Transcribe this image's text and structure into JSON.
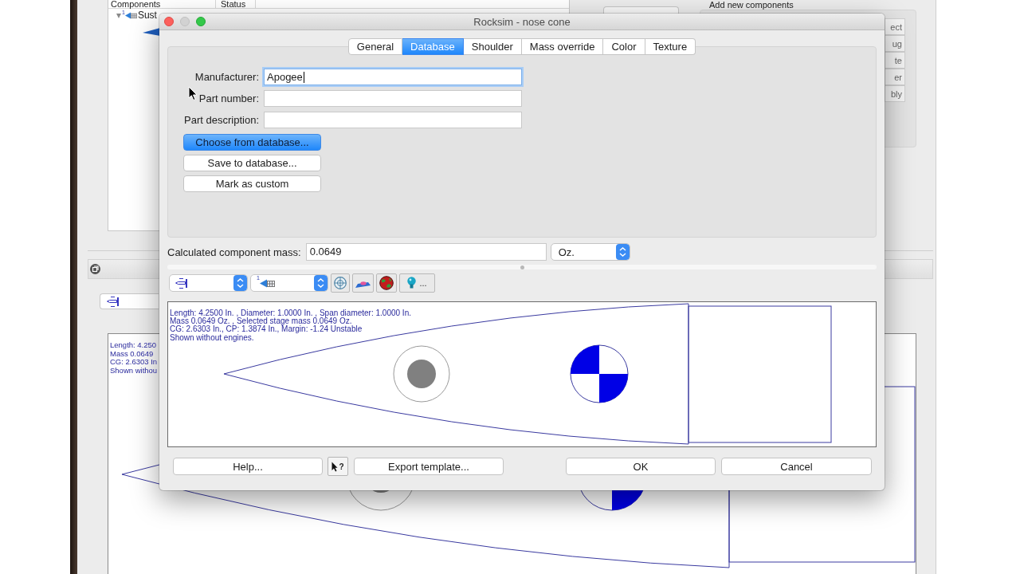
{
  "background_window": {
    "components_list": {
      "columns": [
        "Components",
        "Status"
      ],
      "items": [
        {
          "stage_number": "1",
          "label": "Sust",
          "expanded": true
        }
      ]
    },
    "add_components": {
      "title": "Add new components",
      "buttons": [
        "ect",
        "ug",
        "te",
        "er",
        "bly"
      ]
    },
    "drawing": {
      "info_lines": [
        "Length: 4.250",
        "Mass 0.0649",
        "CG: 2.6303 In",
        "Shown withou"
      ]
    }
  },
  "dialog": {
    "title": "Rocksim - nose cone",
    "tabs": [
      {
        "label": "General",
        "selected": false
      },
      {
        "label": "Database",
        "selected": true
      },
      {
        "label": "Shoulder",
        "selected": false
      },
      {
        "label": "Mass override",
        "selected": false
      },
      {
        "label": "Color",
        "selected": false
      },
      {
        "label": "Texture",
        "selected": false
      }
    ],
    "fields": [
      {
        "label": "Manufacturer:",
        "value": "Apogee",
        "focused": true
      },
      {
        "label": "Part number:",
        "focused": false
      },
      {
        "label": "Part description:",
        "focused": false
      }
    ],
    "database_buttons": [
      {
        "label": "Choose from database...",
        "default": true
      },
      {
        "label": "Save to database...",
        "default": false
      },
      {
        "label": "Mark as custom",
        "default": false
      }
    ],
    "mass": {
      "label": "Calculated component mass:",
      "value": "0.0649",
      "unit": "Oz."
    },
    "toolbar": {
      "stage_number": "1",
      "more_label": "..."
    },
    "drawing": {
      "info_lines": [
        "Length: 4.2500 In. , Diameter: 1.0000 In. , Span diameter: 1.0000 In.",
        "Mass 0.0649 Oz. , Selected stage mass 0.0649 Oz.",
        "CG: 2.6303 In., CP: 1.3874 In., Margin: -1.24 Unstable",
        "Shown without engines."
      ]
    },
    "footer": {
      "buttons": [
        "Help...",
        "Export template...",
        "OK",
        "Cancel"
      ],
      "context_help_mark": "?"
    }
  }
}
